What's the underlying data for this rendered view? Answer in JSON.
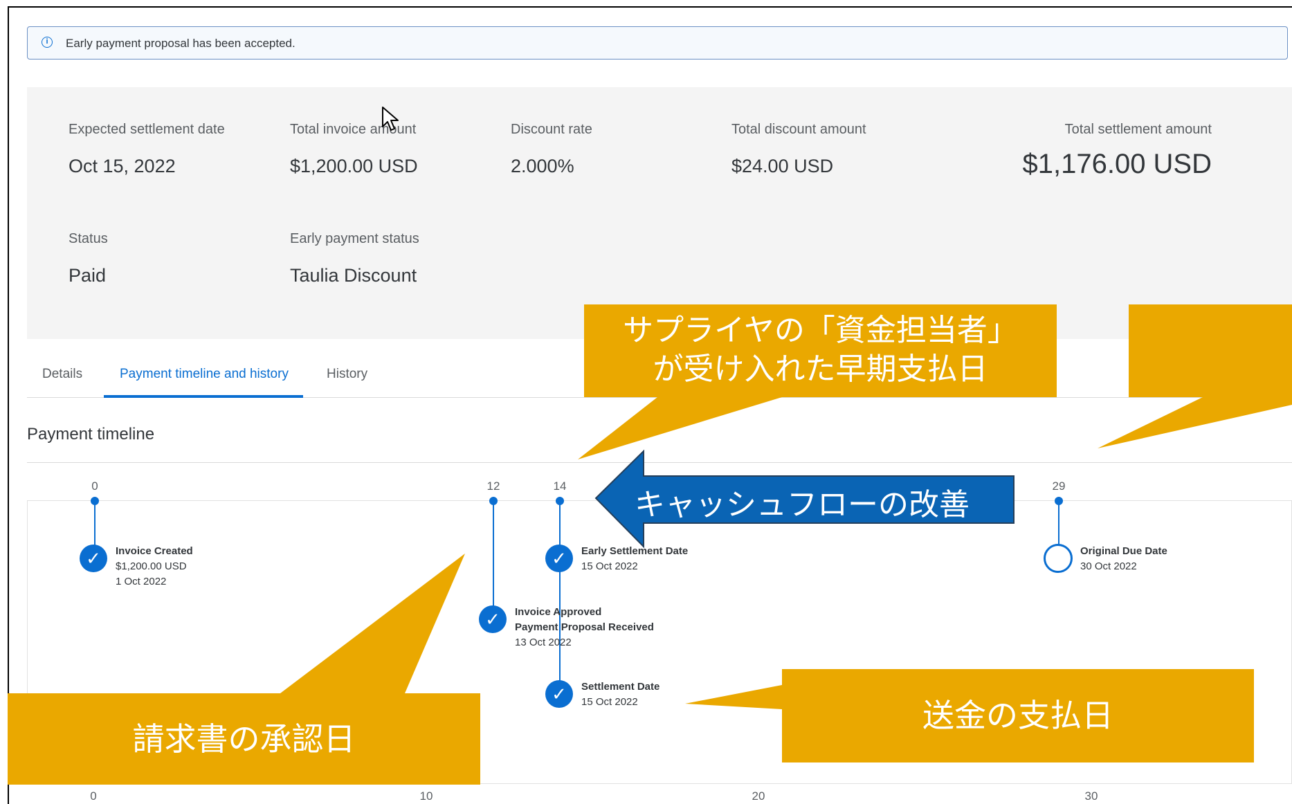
{
  "banner": {
    "text": "Early payment proposal has been accepted."
  },
  "summary": {
    "fields": [
      {
        "label": "Expected settlement date",
        "value": "Oct 15, 2022"
      },
      {
        "label": "Total invoice amount",
        "value": "$1,200.00 USD"
      },
      {
        "label": "Discount rate",
        "value": "2.000%"
      },
      {
        "label": "Total discount amount",
        "value": "$24.00 USD"
      },
      {
        "label": "Total settlement amount",
        "value": "$1,176.00 USD"
      },
      {
        "label": "Status",
        "value": "Paid"
      },
      {
        "label": "Early payment status",
        "value": "Taulia Discount"
      }
    ]
  },
  "tabs": [
    "Details",
    "Payment timeline and history",
    "History"
  ],
  "active_tab": "Payment timeline and history",
  "timeline": {
    "title": "Payment timeline",
    "top_days": [
      "0",
      "12",
      "14",
      "29"
    ],
    "bottom_axis": [
      "0",
      "10",
      "20",
      "30"
    ],
    "milestones": [
      {
        "title": "Invoice Created",
        "lines": [
          "$1,200.00 USD",
          "1 Oct 2022"
        ],
        "done": true
      },
      {
        "title": "Invoice Approved",
        "lines": [
          "Payment Proposal Received",
          "13 Oct 2022"
        ],
        "done": true
      },
      {
        "title": "Early Settlement Date",
        "lines": [
          "15 Oct 2022"
        ],
        "done": true
      },
      {
        "title": "Settlement Date",
        "lines": [
          "15 Oct 2022"
        ],
        "done": true
      },
      {
        "title": "Original Due Date",
        "lines": [
          "30 Oct 2022"
        ],
        "done": false
      }
    ]
  },
  "annotations": {
    "early_payment_callout": [
      "サプライヤの「資金担当者」",
      "が受け入れた早期支払日"
    ],
    "cashflow_arrow": "キャッシュフローの改善",
    "approval_callout": "請求書の承認日",
    "payment_callout": "送金の支払日"
  },
  "colors": {
    "accent": "#0a6ed1",
    "callout": "#eaa800",
    "arrow": "#0a64b4"
  }
}
